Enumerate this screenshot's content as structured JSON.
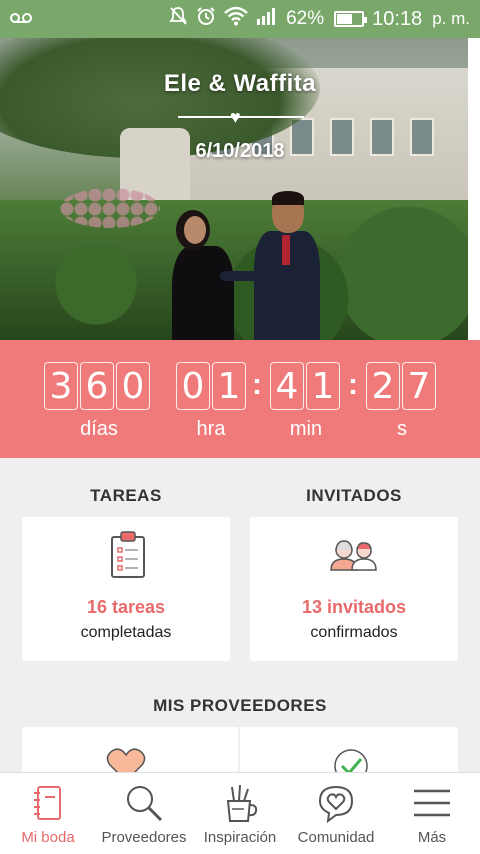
{
  "status_bar": {
    "battery": "62%",
    "battery_level": 0.62,
    "time": "10:18",
    "ampm": "p. m.",
    "icons": [
      "voicemail-icon",
      "mute-icon",
      "alarm-icon",
      "wifi-icon",
      "signal-icon",
      "battery-icon"
    ]
  },
  "hero": {
    "couple": "Ele & Waffita",
    "date": "6/10/2018"
  },
  "countdown": {
    "days": [
      "3",
      "6",
      "0"
    ],
    "hours": [
      "0",
      "1"
    ],
    "minutes": [
      "4",
      "1"
    ],
    "seconds": [
      "2",
      "7"
    ],
    "labels": {
      "days": "días",
      "hours": "hra",
      "minutes": "min",
      "seconds": "s"
    }
  },
  "tasks": {
    "title": "TAREAS",
    "count": "16 tareas",
    "sub": "completadas",
    "icon": "clipboard-icon"
  },
  "guests": {
    "title": "INVITADOS",
    "count": "13 invitados",
    "sub": "confirmados",
    "icon": "guests-icon"
  },
  "vendors": {
    "title": "MIS PROVEEDORES",
    "icons": [
      "heart-icon",
      "check-icon"
    ]
  },
  "colors": {
    "accent": "#f07a79",
    "accent_text": "#e86a6a",
    "status_bar": "#7aa86a"
  },
  "bottom_nav": [
    {
      "label": "Mi boda",
      "icon": "notebook-icon",
      "active": true
    },
    {
      "label": "Proveedores",
      "icon": "search-icon",
      "active": false
    },
    {
      "label": "Inspiración",
      "icon": "pencil-cup-icon",
      "active": false
    },
    {
      "label": "Comunidad",
      "icon": "chat-heart-icon",
      "active": false
    },
    {
      "label": "Más",
      "icon": "menu-icon",
      "active": false
    }
  ]
}
